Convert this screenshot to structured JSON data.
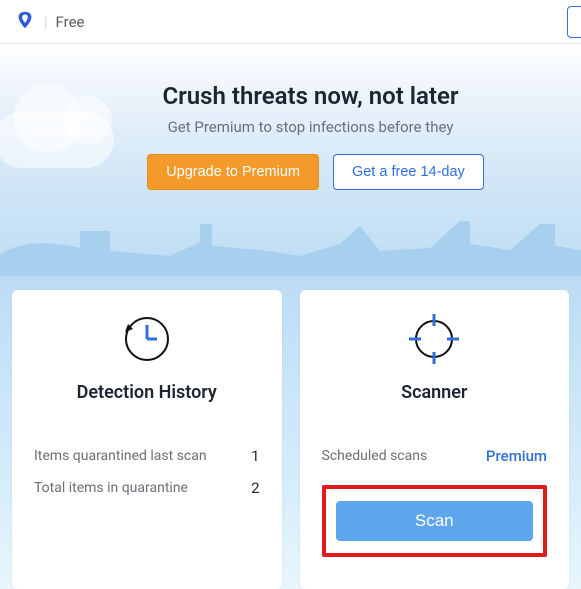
{
  "header": {
    "tier_label": "Free"
  },
  "hero": {
    "title": "Crush threats now, not later",
    "subtitle": "Get Premium to stop infections before they",
    "upgrade_label": "Upgrade to Premium",
    "trial_label": "Get a free 14-day"
  },
  "cards": {
    "history": {
      "title": "Detection History",
      "row1_label": "Items quarantined last scan",
      "row1_value": "1",
      "row2_label": "Total items in quarantine",
      "row2_value": "2"
    },
    "scanner": {
      "title": "Scanner",
      "row1_label": "Scheduled scans",
      "row1_badge": "Premium",
      "scan_label": "Scan"
    }
  }
}
